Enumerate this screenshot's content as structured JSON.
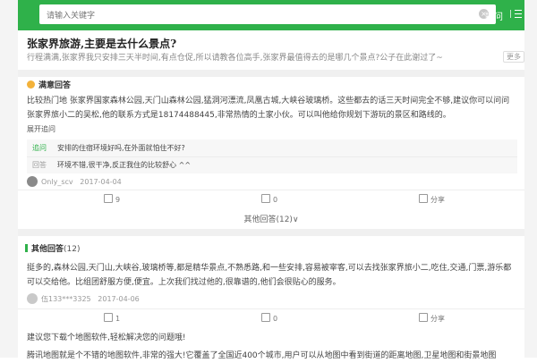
{
  "header": {
    "search_placeholder": "请输入关键字",
    "clear_glyph": "×",
    "search_label": "搜问"
  },
  "question": {
    "title": "张家界旅游,主要是去什么景点?",
    "description": "行程满满,张家界我只安排三天半时间,有点仓促,所以请教各位高手,张家界最值得去的是哪几个景点?公子在此谢过了~",
    "more_label": "更多"
  },
  "best_answer": {
    "heading": "满意回答",
    "text": "比较热门地 张家界国家森林公园,天门山森林公园,猛洞河漂流,凤凰古城,大峡谷玻璃桥。这些都去的话三天时间完全不够,建议你可以问问张家界旅小二的吴松,他的联系方式是18174488445,非常热情的土家小伙。可以叫他给你规划下游玩的景区和路线的。",
    "expand_label": "展开追问",
    "followups": [
      {
        "tag": "追问",
        "text": "安排的住宿环境好吗,在外面就怕住不好?"
      },
      {
        "tag": "回答",
        "text": "环境不错,很干净,反正我住的比较舒心 ^^"
      }
    ],
    "user": "Only_scv",
    "date": "2017-04-04",
    "likes": "9",
    "dislikes": "0",
    "share_label": "分享"
  },
  "other_answers_link": "其他回答(12)∨",
  "other_answers": {
    "heading": "其他回答",
    "count": "(12)",
    "items": [
      {
        "text": "挺多的,森林公园,天门山,大峡谷,玻璃桥等,都是精华景点,不熟悉路,和一些安排,容易被宰客,可以去找张家界旅小二,吃住,交通,门票,游乐都可以交给他。比组团舒服方便,便宜。上次我们找过他的,很靠谱的,他们会很贴心的服务。",
        "user": "伍133***3325",
        "date": "2017-04-06",
        "likes": "1",
        "dislikes": "0",
        "share_label": "分享"
      }
    ],
    "next_text": "建议您下载个地图软件,轻松解决您的问题哦!",
    "next_text_2": "腾讯地图就是个不错的地图软件,非常的强大!它覆盖了全国近400个城市,用户可以从地图中看到街道的距离地图,卫星地图和街景地图"
  }
}
